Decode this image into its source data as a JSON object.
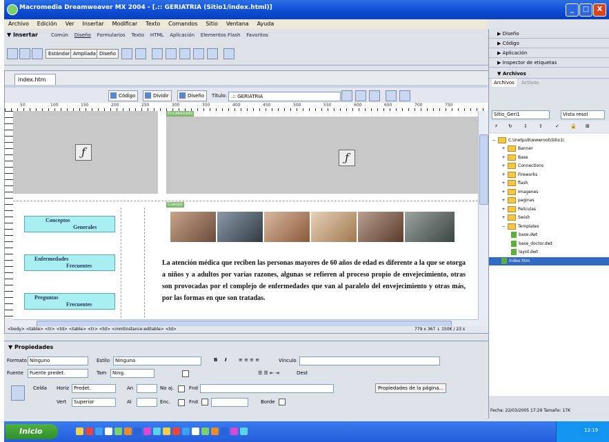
{
  "window": {
    "title": "Macromedia Dreamweaver MX 2004 - [.:: GERIATRIA (Sitio1/index.html)]",
    "controls": [
      "_",
      "□",
      "X"
    ]
  },
  "menubar": [
    "Archivo",
    "Edición",
    "Ver",
    "Insertar",
    "Modificar",
    "Texto",
    "Comandos",
    "Sitio",
    "Ventana",
    "Ayuda"
  ],
  "insertbar": {
    "title": "Insertar",
    "tabs": [
      "Común",
      "Diseño",
      "Formularios",
      "Texto",
      "HTML",
      "Aplicación",
      "Elementos Flash",
      "Favoritos"
    ],
    "selected_tab": "Diseño",
    "view_buttons": [
      "Estándar",
      "Ampliada",
      "Diseño"
    ]
  },
  "document": {
    "tab_label": "index.htm",
    "view_buttons": [
      "Código",
      "Dividir",
      "Diseño"
    ],
    "title_label": "Título:",
    "title_value": ".:: GERIATRIA",
    "ruler_ticks": [
      "50",
      "100",
      "150",
      "200",
      "250",
      "300",
      "350",
      "400",
      "450",
      "500",
      "550",
      "600",
      "650",
      "700",
      "750"
    ],
    "regions": {
      "top": "Encabezado",
      "main": "Cuerpo"
    },
    "nav_items": [
      {
        "line1": "Conceptos",
        "line2": "Generales"
      },
      {
        "line1": "Enfermedades",
        "line2": "Frecuentes"
      },
      {
        "line1": "Preguntas",
        "line2": "Frecuentes"
      }
    ],
    "body_text": "La atención médica que reciben las personas mayores de 60 años de edad es diferente a la que se otorga a niños y a adultos por varias razones, algunas se refieren al proceso propio de envejecimiento, otras son provocadas por el complejo de enfermedades que van al paralelo del envejecimiento y otras más, por las formas en que son tratadas.",
    "status_tags": "<body> <table> <tr> <td> <table> <tr> <td> <mmtinstance:editable> <td>",
    "status_size": "779 x 367 ↓ 150K / 23 s"
  },
  "properties": {
    "title": "Propiedades",
    "formato_label": "Formato",
    "formato_value": "Ninguno",
    "estilo_label": "Estilo",
    "estilo_value": "Ninguna",
    "vinculo_label": "Vínculo",
    "fuente_label": "Fuente",
    "fuente_value": "Fuente predet.",
    "tam_label": "Tam",
    "tam_value": "Ning.",
    "dest_label": "Dest",
    "celda_label": "Celda",
    "horiz_label": "Horiz",
    "horiz_value": "Predet.",
    "vert_label": "Vert",
    "vert_value": "Superior",
    "an_label": "An",
    "al_label": "Al",
    "noaj_label": "No aj.",
    "enc_label": "Enc.",
    "fnd_label": "Fnd",
    "borde_label": "Borde",
    "page_props_button": "Propiedades de la página..."
  },
  "rightpanel": {
    "collapsed": [
      "Diseño",
      "Código",
      "Aplicación",
      "Inspector de etiquetas"
    ],
    "files_panel": "Archivos",
    "tabs": [
      "Archivos",
      "Activos"
    ],
    "site_select": "Sitio_Geri1",
    "view_select": "Vista resol",
    "root": "C:\\Inetpub\\wwwroot\\Sitio1\\",
    "tree": [
      {
        "label": "Banner",
        "type": "folder",
        "exp": "+"
      },
      {
        "label": "Base",
        "type": "folder",
        "exp": "+"
      },
      {
        "label": "Connections",
        "type": "folder",
        "exp": "+"
      },
      {
        "label": "Fireworks",
        "type": "folder",
        "exp": "+"
      },
      {
        "label": "flash",
        "type": "folder",
        "exp": "+"
      },
      {
        "label": "Imagenes",
        "type": "folder",
        "exp": "+"
      },
      {
        "label": "paginas",
        "type": "folder",
        "exp": "+"
      },
      {
        "label": "Peliculas",
        "type": "folder",
        "exp": "+"
      },
      {
        "label": "Swish",
        "type": "folder",
        "exp": "+"
      },
      {
        "label": "Templates",
        "type": "folder",
        "exp": "−"
      },
      {
        "label": "base.dwt",
        "type": "file",
        "indent": 2
      },
      {
        "label": "base_doctor.dwt",
        "type": "file",
        "indent": 2
      },
      {
        "label": "layot.dwt",
        "type": "file",
        "indent": 2
      },
      {
        "label": "index.htm",
        "type": "file",
        "indent": 1,
        "selected": true
      }
    ],
    "footer": "Fecha: 22/03/2005 17:29  Tamaño: 17K"
  },
  "taskbar": {
    "start": "Inicio",
    "clock": "12:19"
  },
  "colors": {
    "titlebar": "#0b4bd6",
    "nav_button": "#a9eff2",
    "region_tag": "#7db86b",
    "selection": "#316ac5"
  }
}
